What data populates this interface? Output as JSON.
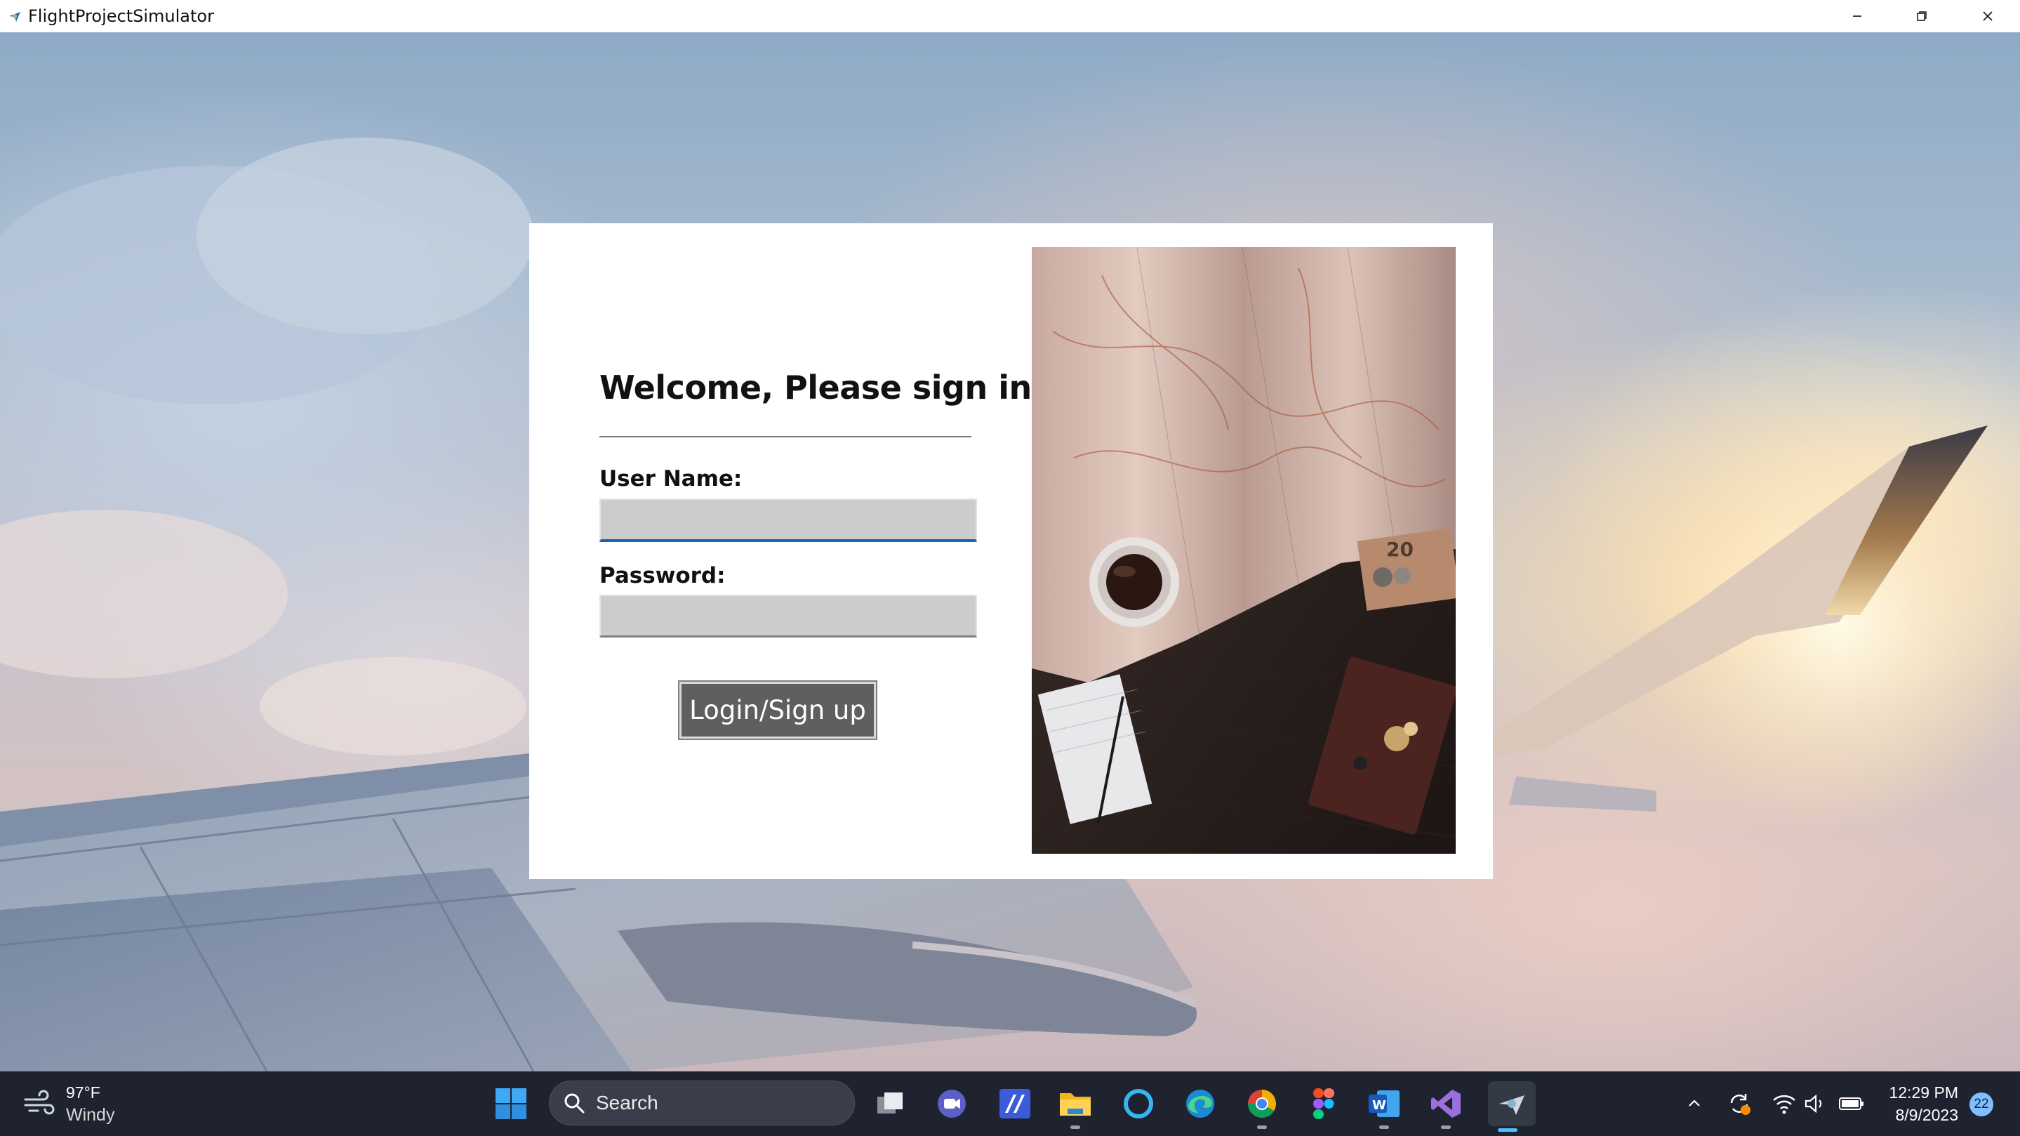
{
  "window": {
    "title": "FlightProjectSimulator"
  },
  "login": {
    "heading": "Welcome, Please sign in",
    "username_label": "User Name:",
    "username_value": "",
    "password_label": "Password:",
    "password_value": "",
    "button_label": "Login/Sign up"
  },
  "taskbar": {
    "weather": {
      "temp": "97°F",
      "condition": "Windy",
      "icon": "wind-icon"
    },
    "search_label": "Search",
    "pinned_apps": [
      "task-view",
      "teams-chat",
      "visual-studio-code-like",
      "file-explorer",
      "cortana",
      "edge",
      "chrome",
      "figma",
      "word",
      "visual-studio",
      "flight-project-simulator"
    ],
    "clock": {
      "time": "12:29 PM",
      "date": "8/9/2023"
    },
    "notification_count": "22"
  },
  "colors": {
    "login_button": "#5f5f5f",
    "active_field_underline": "#1a63b5",
    "taskbar": "#1f2330",
    "field_fill": "#cccccc"
  }
}
